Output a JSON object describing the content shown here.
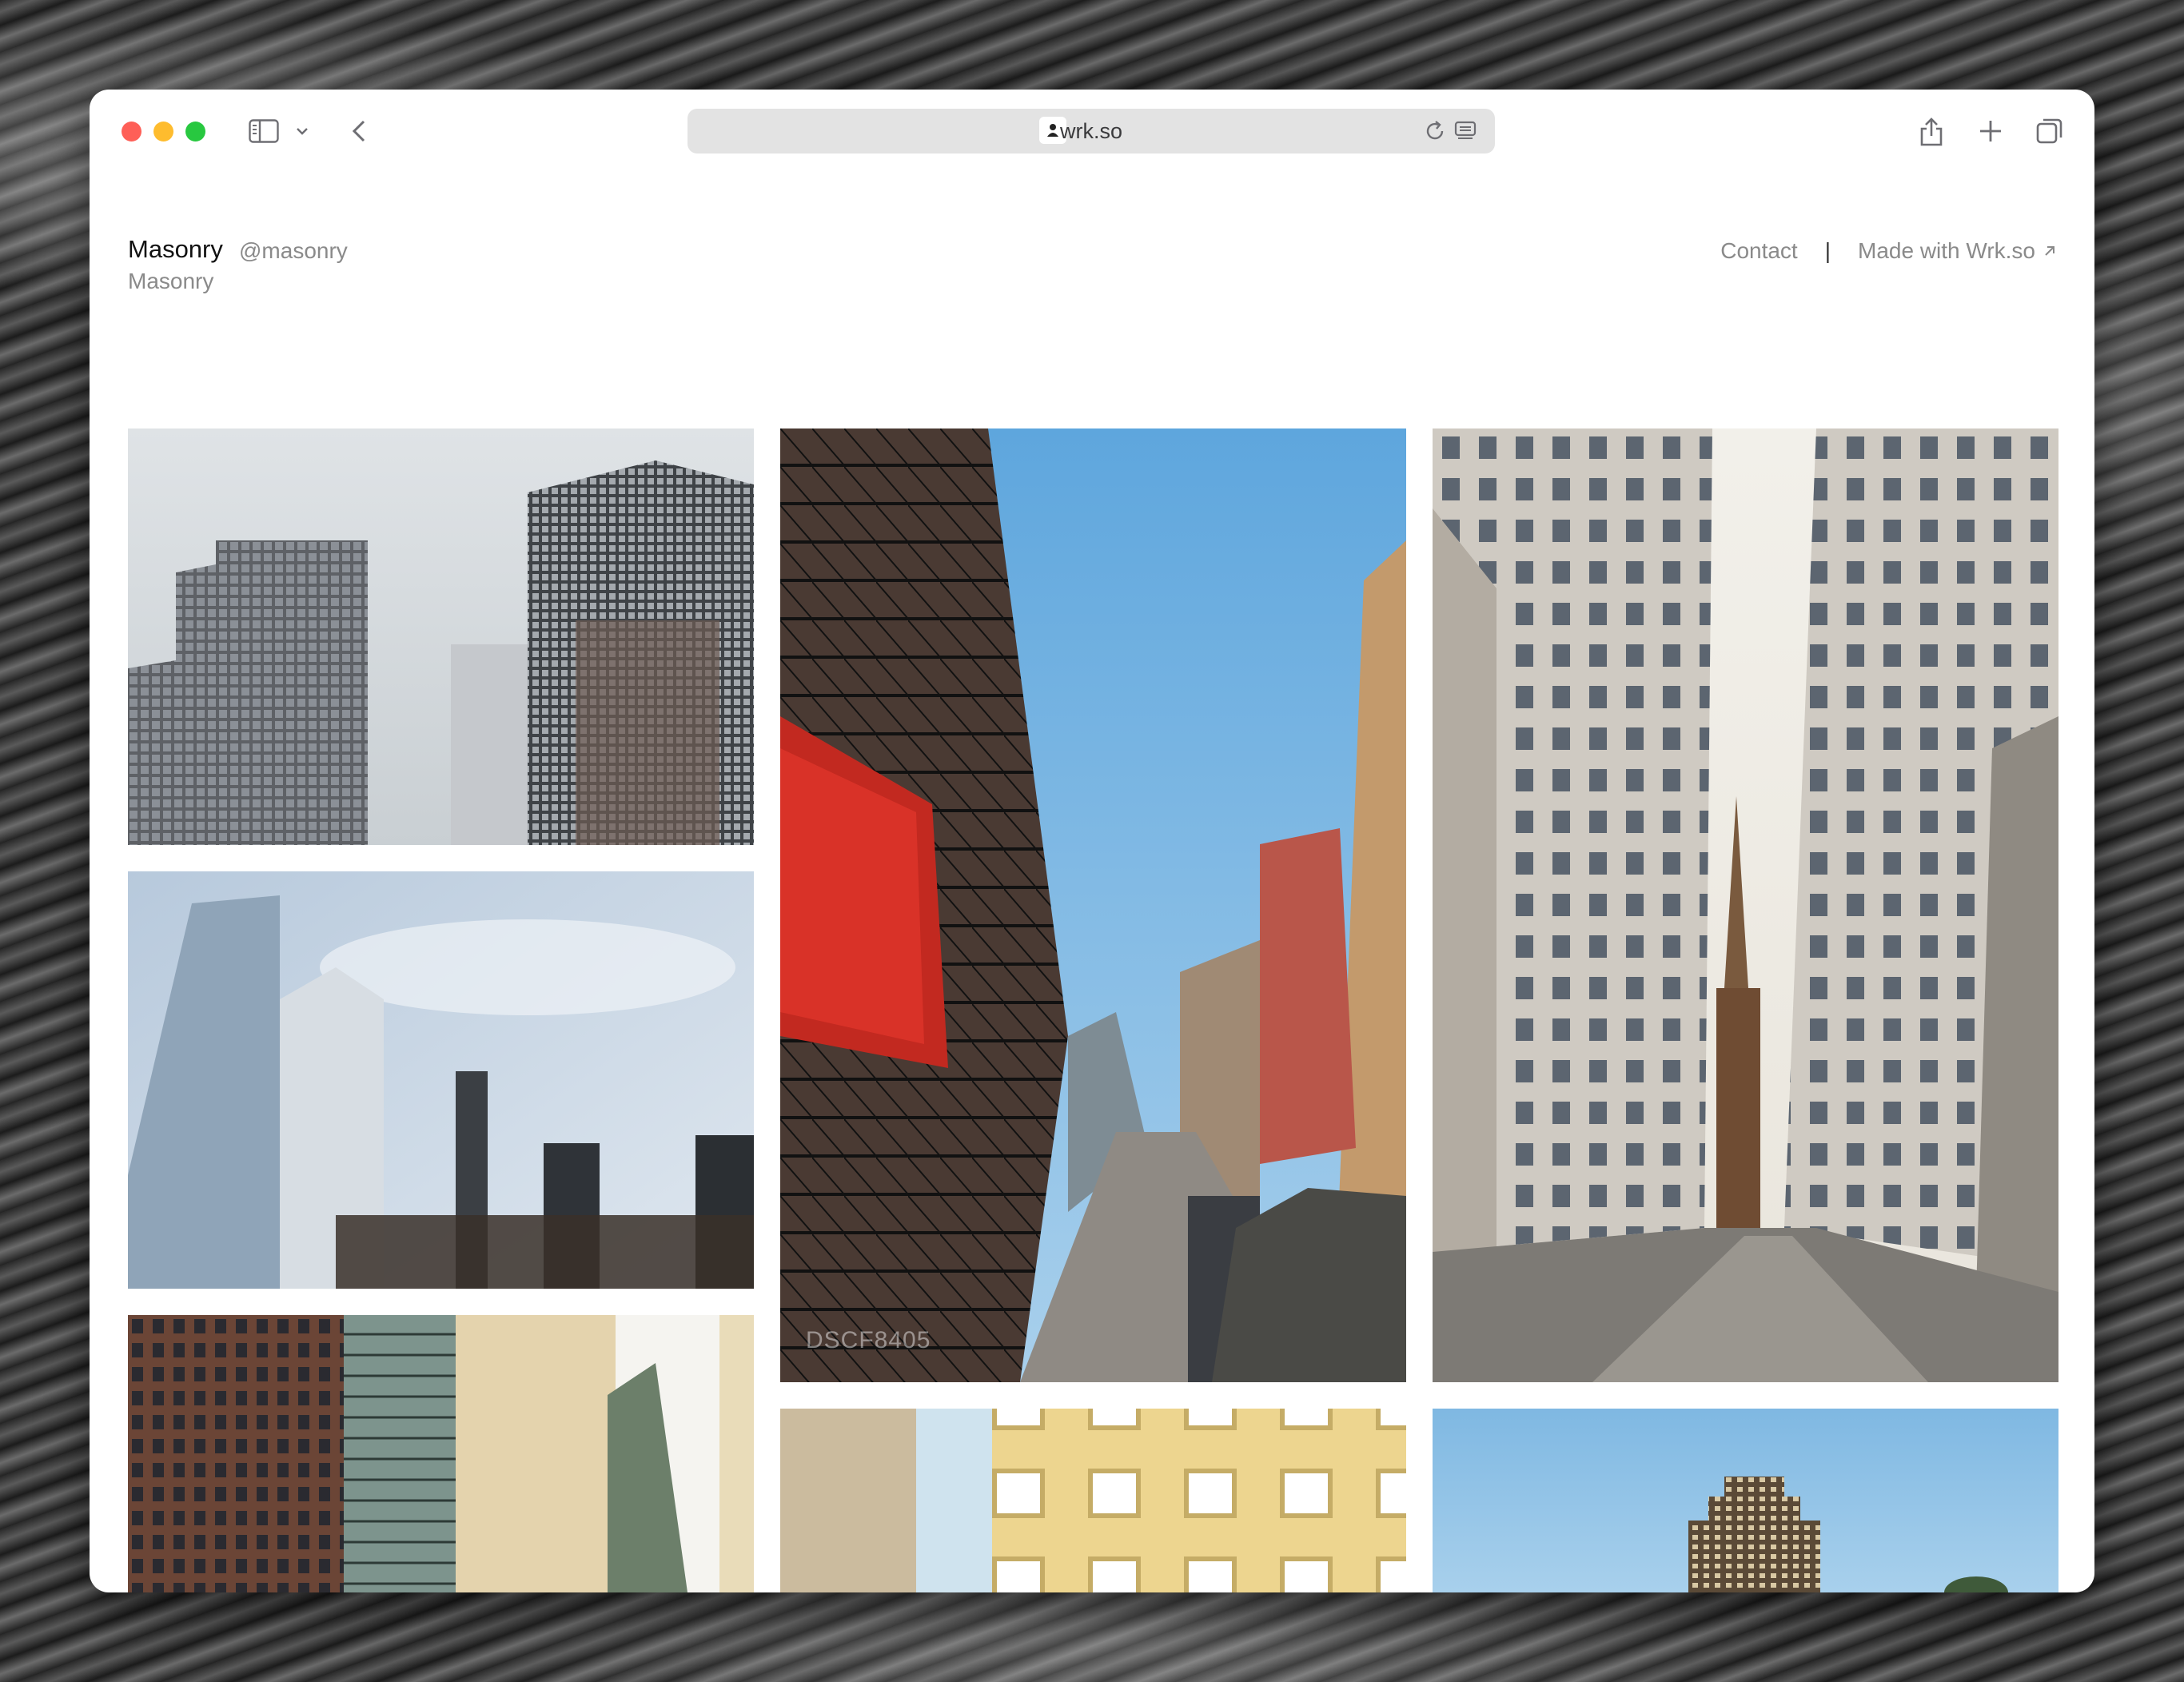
{
  "browser": {
    "url": "wrk.so"
  },
  "site": {
    "name": "Masonry",
    "handle": "@masonry",
    "subtitle": "Masonry"
  },
  "nav": {
    "contact": "Contact",
    "separator": "|",
    "made_with": "Made with Wrk.so"
  },
  "gallery": {
    "photos": [
      {
        "name": "glass-skyscrapers-photo"
      },
      {
        "name": "chinatown-street-photo",
        "caption": "DSCF8405"
      },
      {
        "name": "wall-street-church-photo"
      },
      {
        "name": "downtown-towers-photo"
      },
      {
        "name": "brick-and-glass-buildings-photo"
      },
      {
        "name": "yellow-facade-photo"
      },
      {
        "name": "tower-against-sky-photo"
      }
    ]
  },
  "icons": [
    "sidebar-icon",
    "chevron-down-icon",
    "back-icon",
    "lock-icon",
    "reload-icon",
    "reader-icon",
    "share-icon",
    "plus-icon",
    "tabs-icon",
    "arrow-up-right-icon"
  ]
}
